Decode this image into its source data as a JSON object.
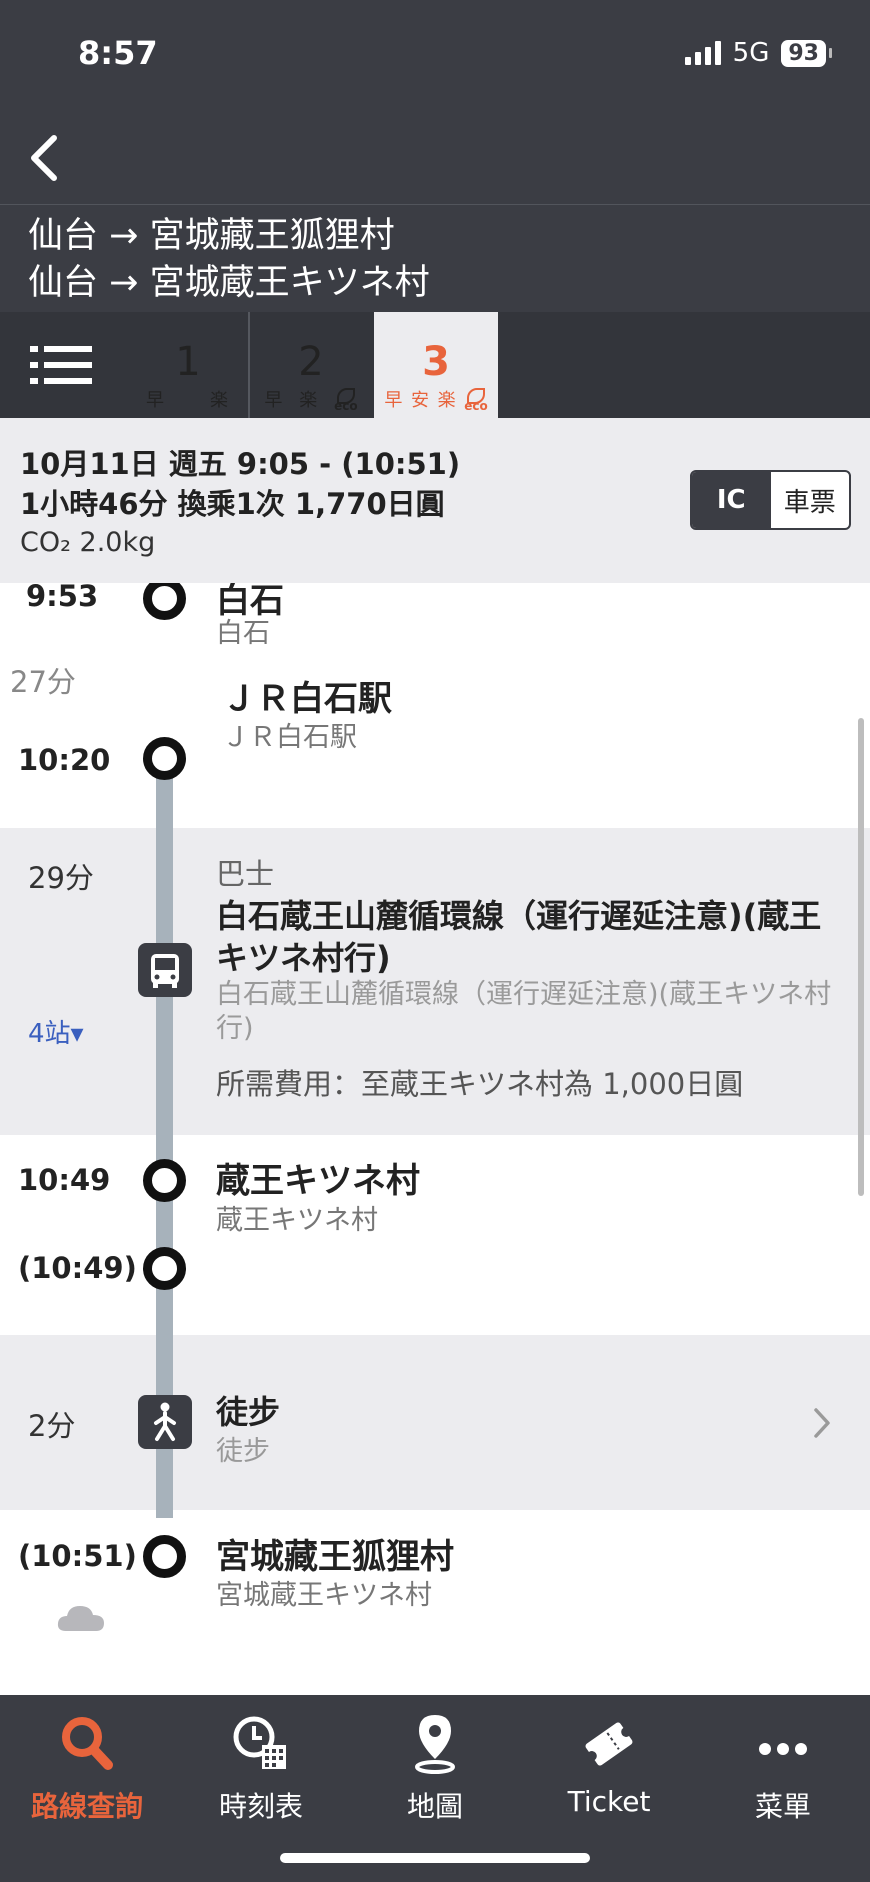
{
  "status_bar": {
    "time": "8:57",
    "network": "5G",
    "battery": "93"
  },
  "route_header": {
    "line1": "仙台 → 宮城藏王狐狸村",
    "line2": "仙台 → 宮城蔵王キツネ村"
  },
  "route_tabs": [
    {
      "num": "1",
      "tags": [
        "早",
        "楽"
      ],
      "eco": false
    },
    {
      "num": "2",
      "tags": [
        "早",
        "楽"
      ],
      "eco": true
    },
    {
      "num": "3",
      "tags": [
        "早",
        "安",
        "楽"
      ],
      "eco": true,
      "active": true
    }
  ],
  "eco_label": "eco",
  "summary": {
    "line1": "10月11日 週五  9:05 - (10:51)",
    "line2": "1小時46分 換乘1次 1,770日圓",
    "line3": "CO₂ 2.0kg",
    "toggle_ic": "IC",
    "toggle_ticket": "車票"
  },
  "timeline": {
    "stop_shiroishi": {
      "time": "9:53",
      "name": "白石",
      "sub": "白石"
    },
    "wait": {
      "duration": "27分"
    },
    "stop_jr": {
      "time": "10:20",
      "name": "ＪＲ白石駅",
      "sub": "ＪＲ白石駅"
    },
    "bus": {
      "duration": "29分",
      "type": "巴士",
      "line_name": "白石蔵王山麓循環線（運行遅延注意)(蔵王キツネ村行)",
      "line_sub": "白石蔵王山麓循環線（運行遅延注意)(蔵王キツネ村行)",
      "stops": "4站▾",
      "fare": "所需費用：至蔵王キツネ村為 1,000日圓"
    },
    "stop_zao": {
      "time": "10:49",
      "name": "蔵王キツネ村",
      "sub": "蔵王キツネ村"
    },
    "stop_zao_dep": {
      "time": "(10:49)"
    },
    "walk": {
      "duration": "2分",
      "label": "徒步",
      "sub": "徒步"
    },
    "stop_final": {
      "time": "(10:51)",
      "name": "宮城藏王狐狸村",
      "sub": "宮城蔵王キツネ村"
    }
  },
  "bottom_nav": [
    {
      "label": "路線查詢",
      "icon": "search-icon",
      "active": true
    },
    {
      "label": "時刻表",
      "icon": "timetable-icon"
    },
    {
      "label": "地圖",
      "icon": "map-pin-icon"
    },
    {
      "label": "Ticket",
      "icon": "ticket-icon"
    },
    {
      "label": "菜單",
      "icon": "more-icon"
    }
  ],
  "colors": {
    "accent": "#e8643c",
    "dark": "#3b3d44",
    "band": "#ececef",
    "line": "#a7b2bb",
    "link": "#3a5fbf"
  }
}
